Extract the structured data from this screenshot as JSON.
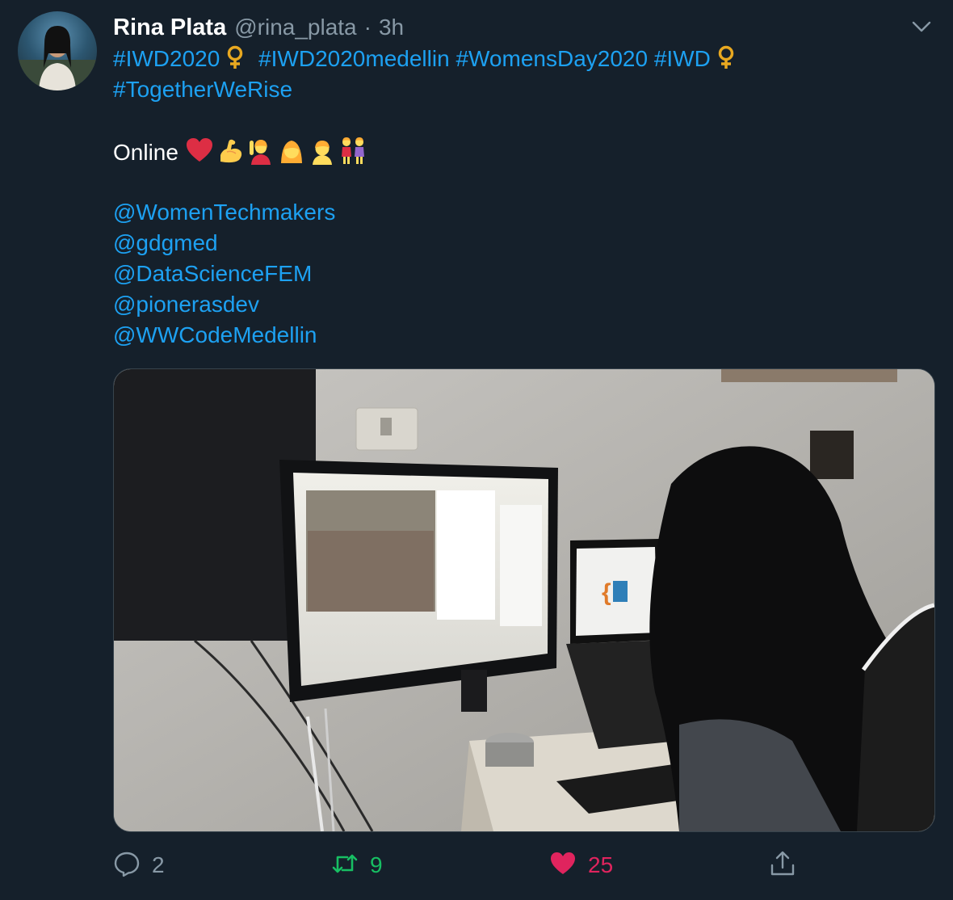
{
  "tweet": {
    "author_name": "Rina Plata",
    "author_handle": "@rina_plata",
    "separator": "·",
    "timestamp": "3h",
    "hashtags_line1": [
      "#IWD2020",
      "#IWD2020medellin",
      "#WomensDay2020",
      "#IWD"
    ],
    "hashtags_line2": "#TogetherWeRise",
    "online_text": "Online",
    "emojis": [
      "heart-emoji",
      "flexed-biceps-emoji",
      "woman-raising-hand-emoji",
      "woman-emoji",
      "person-emoji",
      "two-women-holding-hands-emoji"
    ],
    "mentions": [
      "@WomenTechmakers",
      "@gdgmed",
      "@DataScienceFEM",
      "@pionerasdev",
      "@WWCodeMedellin"
    ],
    "media_description": "photo-of-woman-at-desk-with-monitor-and-laptop"
  },
  "actions": {
    "reply_count": "2",
    "retweet_count": "9",
    "like_count": "25"
  },
  "colors": {
    "background": "#15202b",
    "link": "#1da1f2",
    "muted": "#8899a6",
    "retweet": "#17bf63",
    "like": "#e0245e"
  }
}
